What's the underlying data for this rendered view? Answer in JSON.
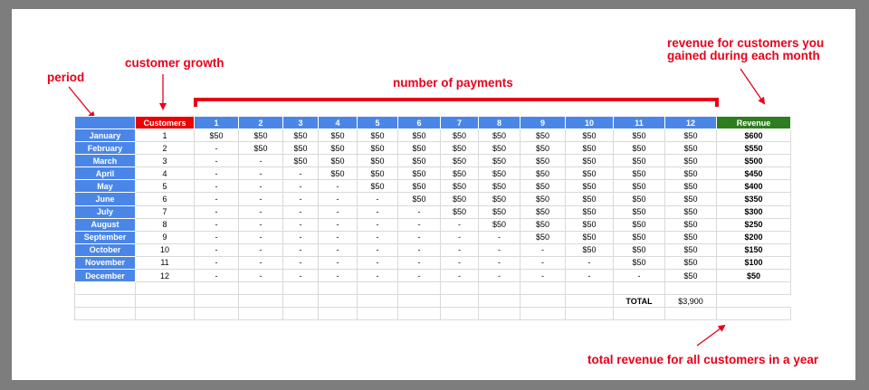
{
  "annotations": {
    "period": "period",
    "customer_growth": "customer growth",
    "number_of_payments": "number of payments",
    "revenue_note_line1": "revenue for customers you",
    "revenue_note_line2": "gained during each month",
    "total_note": "total revenue for all customers in a year"
  },
  "header": {
    "customers": "Customers",
    "payments": [
      "1",
      "2",
      "3",
      "4",
      "5",
      "6",
      "7",
      "8",
      "9",
      "10",
      "11",
      "12"
    ],
    "revenue": "Revenue"
  },
  "rows": [
    {
      "month": "January",
      "customers": "1",
      "payments": [
        "$50",
        "$50",
        "$50",
        "$50",
        "$50",
        "$50",
        "$50",
        "$50",
        "$50",
        "$50",
        "$50",
        "$50"
      ],
      "revenue": "$600"
    },
    {
      "month": "February",
      "customers": "2",
      "payments": [
        "-",
        "$50",
        "$50",
        "$50",
        "$50",
        "$50",
        "$50",
        "$50",
        "$50",
        "$50",
        "$50",
        "$50"
      ],
      "revenue": "$550"
    },
    {
      "month": "March",
      "customers": "3",
      "payments": [
        "-",
        "-",
        "$50",
        "$50",
        "$50",
        "$50",
        "$50",
        "$50",
        "$50",
        "$50",
        "$50",
        "$50"
      ],
      "revenue": "$500"
    },
    {
      "month": "April",
      "customers": "4",
      "payments": [
        "-",
        "-",
        "-",
        "$50",
        "$50",
        "$50",
        "$50",
        "$50",
        "$50",
        "$50",
        "$50",
        "$50"
      ],
      "revenue": "$450"
    },
    {
      "month": "May",
      "customers": "5",
      "payments": [
        "-",
        "-",
        "-",
        "-",
        "$50",
        "$50",
        "$50",
        "$50",
        "$50",
        "$50",
        "$50",
        "$50"
      ],
      "revenue": "$400"
    },
    {
      "month": "June",
      "customers": "6",
      "payments": [
        "-",
        "-",
        "-",
        "-",
        "-",
        "$50",
        "$50",
        "$50",
        "$50",
        "$50",
        "$50",
        "$50"
      ],
      "revenue": "$350"
    },
    {
      "month": "July",
      "customers": "7",
      "payments": [
        "-",
        "-",
        "-",
        "-",
        "-",
        "-",
        "$50",
        "$50",
        "$50",
        "$50",
        "$50",
        "$50"
      ],
      "revenue": "$300"
    },
    {
      "month": "August",
      "customers": "8",
      "payments": [
        "-",
        "-",
        "-",
        "-",
        "-",
        "-",
        "-",
        "$50",
        "$50",
        "$50",
        "$50",
        "$50"
      ],
      "revenue": "$250"
    },
    {
      "month": "September",
      "customers": "9",
      "payments": [
        "-",
        "-",
        "-",
        "-",
        "-",
        "-",
        "-",
        "-",
        "$50",
        "$50",
        "$50",
        "$50"
      ],
      "revenue": "$200"
    },
    {
      "month": "October",
      "customers": "10",
      "payments": [
        "-",
        "-",
        "-",
        "-",
        "-",
        "-",
        "-",
        "-",
        "-",
        "$50",
        "$50",
        "$50"
      ],
      "revenue": "$150"
    },
    {
      "month": "November",
      "customers": "11",
      "payments": [
        "-",
        "-",
        "-",
        "-",
        "-",
        "-",
        "-",
        "-",
        "-",
        "-",
        "$50",
        "$50"
      ],
      "revenue": "$100"
    },
    {
      "month": "December",
      "customers": "12",
      "payments": [
        "-",
        "-",
        "-",
        "-",
        "-",
        "-",
        "-",
        "-",
        "-",
        "-",
        "-",
        "$50"
      ],
      "revenue": "$50"
    }
  ],
  "totals": {
    "label": "TOTAL",
    "value": "$3,900"
  },
  "colors": {
    "period_column": "#4a86e8",
    "customers_header": "#ea0000",
    "revenue_header": "#2e7d1f",
    "annotation": "#e8001c"
  }
}
